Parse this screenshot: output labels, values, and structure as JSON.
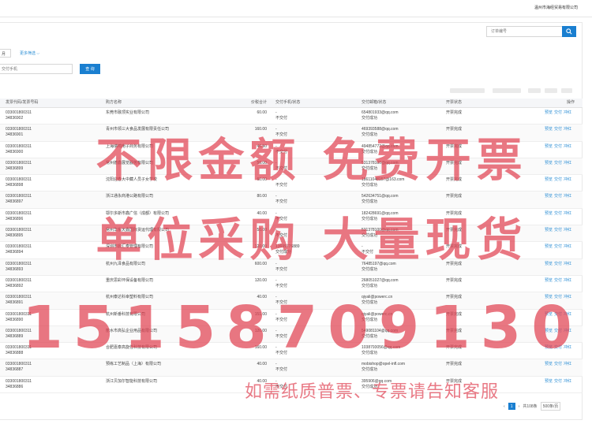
{
  "header": {
    "company": "温州市海经贸易有限公司"
  },
  "search": {
    "placeholder": "订单编号"
  },
  "filters": {
    "month_label": "月",
    "more_label": "更多筛选",
    "phone_placeholder": "交付手机",
    "query_label": "查 询"
  },
  "table": {
    "headers": [
      "发票代码/发票号码",
      "购方名称",
      "价税合计",
      "交付手机/状态",
      "交付邮箱/状态",
      "开票状态",
      "操作"
    ],
    "rows": [
      {
        "code": "033001800311",
        "number": "34836902",
        "buyer": "东莞市融顶实业有限公司",
        "amount": "60.00",
        "phone": "-",
        "phone_status": "不交付",
        "email": "654801933@qq.com",
        "email_status": "交付成功",
        "status": "开票完成"
      },
      {
        "code": "033001800311",
        "number": "34836901",
        "buyer": "青州市领三大食品发展有限责任公司",
        "amount": "160.00",
        "phone": "-",
        "phone_status": "不交付",
        "email": "469393588@qq.com",
        "email_status": "交付成功",
        "status": "开票完成"
      },
      {
        "code": "033001800311",
        "number": "34836900",
        "buyer": "上海瑞鸣电子商务有限公司",
        "amount": "46.50",
        "phone": "-",
        "phone_status": "不交付",
        "email": "494854772@qq.com",
        "email_status": "交付成功",
        "status": "开票完成"
      },
      {
        "code": "033001800311",
        "number": "34836899",
        "buyer": "常州德鑫展览服务有限公司",
        "amount": "50.00",
        "phone": "-",
        "phone_status": "不交付",
        "email": "531378100@qq.com",
        "email_status": "交付成功",
        "status": "开票完成"
      },
      {
        "code": "033001800311",
        "number": "34836898",
        "buyer": "沈阳迎春大中藏人员子女学校",
        "amount": "60.00",
        "phone": "-",
        "phone_status": "不交付",
        "email": "18611048157@163.com",
        "email_status": "交付成功",
        "status": "开票完成"
      },
      {
        "code": "033001800311",
        "number": "34836897",
        "buyer": "浙江通永商港公路有限公司",
        "amount": "80.00",
        "phone": "-",
        "phone_status": "不交付",
        "email": "542634751@qq.com",
        "email_status": "交付成功",
        "status": "开票完成"
      },
      {
        "code": "033001800311",
        "number": "34836896",
        "buyer": "鄂尔多斯市鑫广信（成都）有限公司",
        "amount": "40.00",
        "phone": "-",
        "phone_status": "不交付",
        "email": "182428691@qq.com",
        "email_status": "交付成功",
        "status": "开票完成"
      },
      {
        "code": "033001800311",
        "number": "34836895",
        "buyer": "常州华东天鑫国际货运代理有限公司",
        "amount": "50.00",
        "phone": "-",
        "phone_status": "不交付",
        "email": "531378100@qq.com",
        "email_status": "交付成功",
        "status": "开票完成"
      },
      {
        "code": "033001800311",
        "number": "34836894",
        "buyer": "深圳市鼎汇泰管理有限公司",
        "amount": "120.00",
        "phone": "13699776889",
        "phone_status": "交付成功",
        "email": "-",
        "email_status": "不交付",
        "status": "开票完成"
      },
      {
        "code": "033001800311",
        "number": "34836893",
        "buyer": "杭州九泽食品有限公司",
        "amount": "600.00",
        "phone": "-",
        "phone_status": "不交付",
        "email": "76485197@qq.com",
        "email_status": "交付成功",
        "status": "开票完成"
      },
      {
        "code": "033001800311",
        "number": "34836892",
        "buyer": "重庆思彩环保设备有限公司",
        "amount": "120.00",
        "phone": "-",
        "phone_status": "不交付",
        "email": "268051027@qq.com",
        "email_status": "交付成功",
        "status": "开票完成"
      },
      {
        "code": "033001800311",
        "number": "34836891",
        "buyer": "杭州泰达科幸塑料有限公司",
        "amount": "40.00",
        "phone": "-",
        "phone_status": "不交付",
        "email": "qiyali@powerc.cn",
        "email_status": "交付成功",
        "status": "开票完成"
      },
      {
        "code": "033001800311",
        "number": "34836890",
        "buyer": "杭州新番科技有限公司",
        "amount": "151.00",
        "phone": "-",
        "phone_status": "不交付",
        "email": "qiyali@powerc.cn",
        "email_status": "交付成功",
        "status": "开票完成"
      },
      {
        "code": "033001800311",
        "number": "34836889",
        "buyer": "丽水市高弘企业用品有限公司",
        "amount": "120.00",
        "phone": "-",
        "phone_status": "不交付",
        "email": "549081104@qq.com",
        "email_status": "交付成功",
        "status": "开票完成"
      },
      {
        "code": "033001800311",
        "number": "34836888",
        "buyer": "合肥嘉泰高旋任科技有限公司",
        "amount": "160.00",
        "phone": "-",
        "phone_status": "不交付",
        "email": "1038793056@qq.com",
        "email_status": "交付成功",
        "status": "开票完成"
      },
      {
        "code": "033001800311",
        "number": "34836887",
        "buyer": "预练工艺制品（上海）有限公司",
        "amount": "40.00",
        "phone": "-",
        "phone_status": "不交付",
        "email": "mobishop@opel-infl.com",
        "email_status": "交付成功",
        "status": "开票完成"
      },
      {
        "code": "033001800311",
        "number": "34836886",
        "buyer": "浙江贝加尔智能科技有限公司",
        "amount": "40.00",
        "phone": "-",
        "phone_status": "不交付",
        "email": "395906@qq.com",
        "email_status": "交付成功",
        "status": "开票完成"
      }
    ],
    "actions": [
      "预览",
      "交付",
      "冲红"
    ]
  },
  "pager": {
    "page": "1",
    "next": "›",
    "total": "共108条",
    "size": "500条/页"
  },
  "watermark": {
    "line1": "不限金额 免费开票",
    "line2": "单位采购 大量现货",
    "line3": "15158709130",
    "line4": "如需纸质普票、专票请告知客服"
  },
  "colors": {
    "accent": "#1a7fd0",
    "link": "#2d8fd5",
    "watermark": "#e04252"
  }
}
